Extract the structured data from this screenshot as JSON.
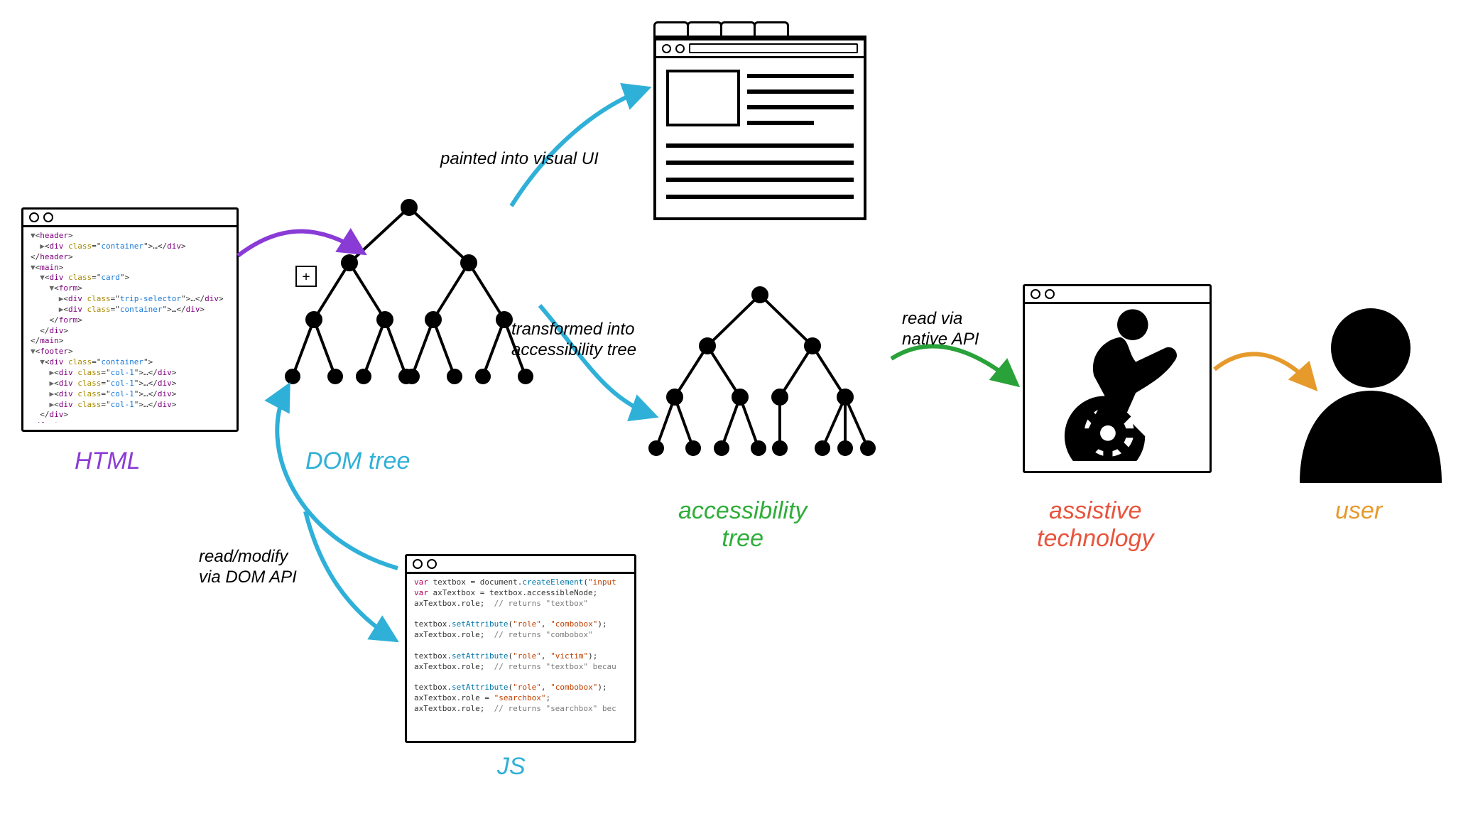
{
  "labels": {
    "html": "HTML",
    "dom_tree": "DOM tree",
    "js": "JS",
    "accessibility_tree_line1": "accessibility",
    "accessibility_tree_line2": "tree",
    "assistive_tech_line1": "assistive",
    "assistive_tech_line2": "technology",
    "user": "user"
  },
  "arrow_text": {
    "painted": "painted into visual UI",
    "transformed_line1": "transformed into",
    "transformed_line2": "accessibility tree",
    "read_modify_line1": "read/modify",
    "read_modify_line2": "via DOM API",
    "read_native_line1": "read via",
    "read_native_line2": "native API"
  },
  "colors": {
    "html_label": "#8a3bd6",
    "dom_label": "#2fb0d8",
    "js_label": "#2fb0d8",
    "a11y_label": "#2fae3a",
    "at_label": "#e8543c",
    "user_label": "#e69a2c",
    "arrow_purple": "#8a3bd6",
    "arrow_blue": "#2fb0d8",
    "arrow_green": "#29a23a",
    "arrow_orange": "#e69a2c"
  },
  "html_code_lines": [
    {
      "indent": 0,
      "parts": [
        {
          "t": "arrow",
          "v": "▼"
        },
        {
          "t": "punc",
          "v": "<"
        },
        {
          "t": "tag",
          "v": "header"
        },
        {
          "t": "punc",
          "v": ">"
        }
      ]
    },
    {
      "indent": 1,
      "parts": [
        {
          "t": "arrow",
          "v": "▶"
        },
        {
          "t": "punc",
          "v": "<"
        },
        {
          "t": "tag",
          "v": "div"
        },
        {
          "t": "punc",
          "v": " "
        },
        {
          "t": "attr",
          "v": "class"
        },
        {
          "t": "punc",
          "v": "=\""
        },
        {
          "t": "val",
          "v": "container"
        },
        {
          "t": "punc",
          "v": "\">…</"
        },
        {
          "t": "tag",
          "v": "div"
        },
        {
          "t": "punc",
          "v": ">"
        }
      ]
    },
    {
      "indent": 0,
      "parts": [
        {
          "t": "punc",
          "v": "</"
        },
        {
          "t": "tag",
          "v": "header"
        },
        {
          "t": "punc",
          "v": ">"
        }
      ]
    },
    {
      "indent": 0,
      "parts": [
        {
          "t": "arrow",
          "v": "▼"
        },
        {
          "t": "punc",
          "v": "<"
        },
        {
          "t": "tag",
          "v": "main"
        },
        {
          "t": "punc",
          "v": ">"
        }
      ]
    },
    {
      "indent": 1,
      "parts": [
        {
          "t": "arrow",
          "v": "▼"
        },
        {
          "t": "punc",
          "v": "<"
        },
        {
          "t": "tag",
          "v": "div"
        },
        {
          "t": "punc",
          "v": " "
        },
        {
          "t": "attr",
          "v": "class"
        },
        {
          "t": "punc",
          "v": "=\""
        },
        {
          "t": "val",
          "v": "card"
        },
        {
          "t": "punc",
          "v": "\">"
        }
      ]
    },
    {
      "indent": 2,
      "parts": [
        {
          "t": "arrow",
          "v": "▼"
        },
        {
          "t": "punc",
          "v": "<"
        },
        {
          "t": "tag",
          "v": "form"
        },
        {
          "t": "punc",
          "v": ">"
        }
      ]
    },
    {
      "indent": 3,
      "parts": [
        {
          "t": "arrow",
          "v": "▶"
        },
        {
          "t": "punc",
          "v": "<"
        },
        {
          "t": "tag",
          "v": "div"
        },
        {
          "t": "punc",
          "v": " "
        },
        {
          "t": "attr",
          "v": "class"
        },
        {
          "t": "punc",
          "v": "=\""
        },
        {
          "t": "val",
          "v": "trip-selector"
        },
        {
          "t": "punc",
          "v": "\">…</"
        },
        {
          "t": "tag",
          "v": "div"
        },
        {
          "t": "punc",
          "v": ">"
        }
      ]
    },
    {
      "indent": 3,
      "parts": [
        {
          "t": "arrow",
          "v": "▶"
        },
        {
          "t": "punc",
          "v": "<"
        },
        {
          "t": "tag",
          "v": "div"
        },
        {
          "t": "punc",
          "v": " "
        },
        {
          "t": "attr",
          "v": "class"
        },
        {
          "t": "punc",
          "v": "=\""
        },
        {
          "t": "val",
          "v": "container"
        },
        {
          "t": "punc",
          "v": "\">…</"
        },
        {
          "t": "tag",
          "v": "div"
        },
        {
          "t": "punc",
          "v": ">"
        }
      ]
    },
    {
      "indent": 2,
      "parts": [
        {
          "t": "punc",
          "v": "</"
        },
        {
          "t": "tag",
          "v": "form"
        },
        {
          "t": "punc",
          "v": ">"
        }
      ]
    },
    {
      "indent": 1,
      "parts": [
        {
          "t": "punc",
          "v": "</"
        },
        {
          "t": "tag",
          "v": "div"
        },
        {
          "t": "punc",
          "v": ">"
        }
      ]
    },
    {
      "indent": 0,
      "parts": [
        {
          "t": "punc",
          "v": "</"
        },
        {
          "t": "tag",
          "v": "main"
        },
        {
          "t": "punc",
          "v": ">"
        }
      ]
    },
    {
      "indent": 0,
      "parts": [
        {
          "t": "arrow",
          "v": "▼"
        },
        {
          "t": "punc",
          "v": "<"
        },
        {
          "t": "tag",
          "v": "footer"
        },
        {
          "t": "punc",
          "v": ">"
        }
      ]
    },
    {
      "indent": 1,
      "parts": [
        {
          "t": "arrow",
          "v": "▼"
        },
        {
          "t": "punc",
          "v": "<"
        },
        {
          "t": "tag",
          "v": "div"
        },
        {
          "t": "punc",
          "v": " "
        },
        {
          "t": "attr",
          "v": "class"
        },
        {
          "t": "punc",
          "v": "=\""
        },
        {
          "t": "val",
          "v": "container"
        },
        {
          "t": "punc",
          "v": "\">"
        }
      ]
    },
    {
      "indent": 2,
      "parts": [
        {
          "t": "arrow",
          "v": "▶"
        },
        {
          "t": "punc",
          "v": "<"
        },
        {
          "t": "tag",
          "v": "div"
        },
        {
          "t": "punc",
          "v": " "
        },
        {
          "t": "attr",
          "v": "class"
        },
        {
          "t": "punc",
          "v": "=\""
        },
        {
          "t": "val",
          "v": "col-1"
        },
        {
          "t": "punc",
          "v": "\">…</"
        },
        {
          "t": "tag",
          "v": "div"
        },
        {
          "t": "punc",
          "v": ">"
        }
      ]
    },
    {
      "indent": 2,
      "parts": [
        {
          "t": "arrow",
          "v": "▶"
        },
        {
          "t": "punc",
          "v": "<"
        },
        {
          "t": "tag",
          "v": "div"
        },
        {
          "t": "punc",
          "v": " "
        },
        {
          "t": "attr",
          "v": "class"
        },
        {
          "t": "punc",
          "v": "=\""
        },
        {
          "t": "val",
          "v": "col-1"
        },
        {
          "t": "punc",
          "v": "\">…</"
        },
        {
          "t": "tag",
          "v": "div"
        },
        {
          "t": "punc",
          "v": ">"
        }
      ]
    },
    {
      "indent": 2,
      "parts": [
        {
          "t": "arrow",
          "v": "▶"
        },
        {
          "t": "punc",
          "v": "<"
        },
        {
          "t": "tag",
          "v": "div"
        },
        {
          "t": "punc",
          "v": " "
        },
        {
          "t": "attr",
          "v": "class"
        },
        {
          "t": "punc",
          "v": "=\""
        },
        {
          "t": "val",
          "v": "col-1"
        },
        {
          "t": "punc",
          "v": "\">…</"
        },
        {
          "t": "tag",
          "v": "div"
        },
        {
          "t": "punc",
          "v": ">"
        }
      ]
    },
    {
      "indent": 2,
      "parts": [
        {
          "t": "arrow",
          "v": "▶"
        },
        {
          "t": "punc",
          "v": "<"
        },
        {
          "t": "tag",
          "v": "div"
        },
        {
          "t": "punc",
          "v": " "
        },
        {
          "t": "attr",
          "v": "class"
        },
        {
          "t": "punc",
          "v": "=\""
        },
        {
          "t": "val",
          "v": "col-1"
        },
        {
          "t": "punc",
          "v": "\">…</"
        },
        {
          "t": "tag",
          "v": "div"
        },
        {
          "t": "punc",
          "v": ">"
        }
      ]
    },
    {
      "indent": 1,
      "parts": [
        {
          "t": "punc",
          "v": "</"
        },
        {
          "t": "tag",
          "v": "div"
        },
        {
          "t": "punc",
          "v": ">"
        }
      ]
    },
    {
      "indent": 0,
      "parts": [
        {
          "t": "punc",
          "v": "</"
        },
        {
          "t": "tag",
          "v": "footer"
        },
        {
          "t": "punc",
          "v": ">"
        }
      ]
    }
  ],
  "js_code_lines": [
    {
      "parts": [
        {
          "t": "kw",
          "v": "var"
        },
        {
          "t": "punc",
          "v": " textbox = document."
        },
        {
          "t": "fn",
          "v": "createElement"
        },
        {
          "t": "punc",
          "v": "("
        },
        {
          "t": "str",
          "v": "\"input"
        }
      ]
    },
    {
      "parts": [
        {
          "t": "kw",
          "v": "var"
        },
        {
          "t": "punc",
          "v": " axTextbox = textbox.accessibleNode;"
        }
      ]
    },
    {
      "parts": [
        {
          "t": "punc",
          "v": "axTextbox.role;  "
        },
        {
          "t": "cmt",
          "v": "// returns \"textbox\""
        }
      ]
    },
    {
      "parts": [
        {
          "t": "punc",
          "v": " "
        }
      ]
    },
    {
      "parts": [
        {
          "t": "punc",
          "v": "textbox."
        },
        {
          "t": "fn",
          "v": "setAttribute"
        },
        {
          "t": "punc",
          "v": "("
        },
        {
          "t": "str",
          "v": "\"role\""
        },
        {
          "t": "punc",
          "v": ", "
        },
        {
          "t": "str",
          "v": "\"combobox\""
        },
        {
          "t": "punc",
          "v": ");"
        }
      ]
    },
    {
      "parts": [
        {
          "t": "punc",
          "v": "axTextbox.role;  "
        },
        {
          "t": "cmt",
          "v": "// returns \"combobox\""
        }
      ]
    },
    {
      "parts": [
        {
          "t": "punc",
          "v": " "
        }
      ]
    },
    {
      "parts": [
        {
          "t": "punc",
          "v": "textbox."
        },
        {
          "t": "fn",
          "v": "setAttribute"
        },
        {
          "t": "punc",
          "v": "("
        },
        {
          "t": "str",
          "v": "\"role\""
        },
        {
          "t": "punc",
          "v": ", "
        },
        {
          "t": "str",
          "v": "\"victim\""
        },
        {
          "t": "punc",
          "v": ");"
        }
      ]
    },
    {
      "parts": [
        {
          "t": "punc",
          "v": "axTextbox.role;  "
        },
        {
          "t": "cmt",
          "v": "// returns \"textbox\" becau"
        }
      ]
    },
    {
      "parts": [
        {
          "t": "punc",
          "v": " "
        }
      ]
    },
    {
      "parts": [
        {
          "t": "punc",
          "v": "textbox."
        },
        {
          "t": "fn",
          "v": "setAttribute"
        },
        {
          "t": "punc",
          "v": "("
        },
        {
          "t": "str",
          "v": "\"role\""
        },
        {
          "t": "punc",
          "v": ", "
        },
        {
          "t": "str",
          "v": "\"combobox\""
        },
        {
          "t": "punc",
          "v": ");"
        }
      ]
    },
    {
      "parts": [
        {
          "t": "punc",
          "v": "axTextbox.role = "
        },
        {
          "t": "str",
          "v": "\"searchbox\""
        },
        {
          "t": "punc",
          "v": ";"
        }
      ]
    },
    {
      "parts": [
        {
          "t": "punc",
          "v": "axTextbox.role;  "
        },
        {
          "t": "cmt",
          "v": "// returns \"searchbox\" bec"
        }
      ]
    }
  ]
}
